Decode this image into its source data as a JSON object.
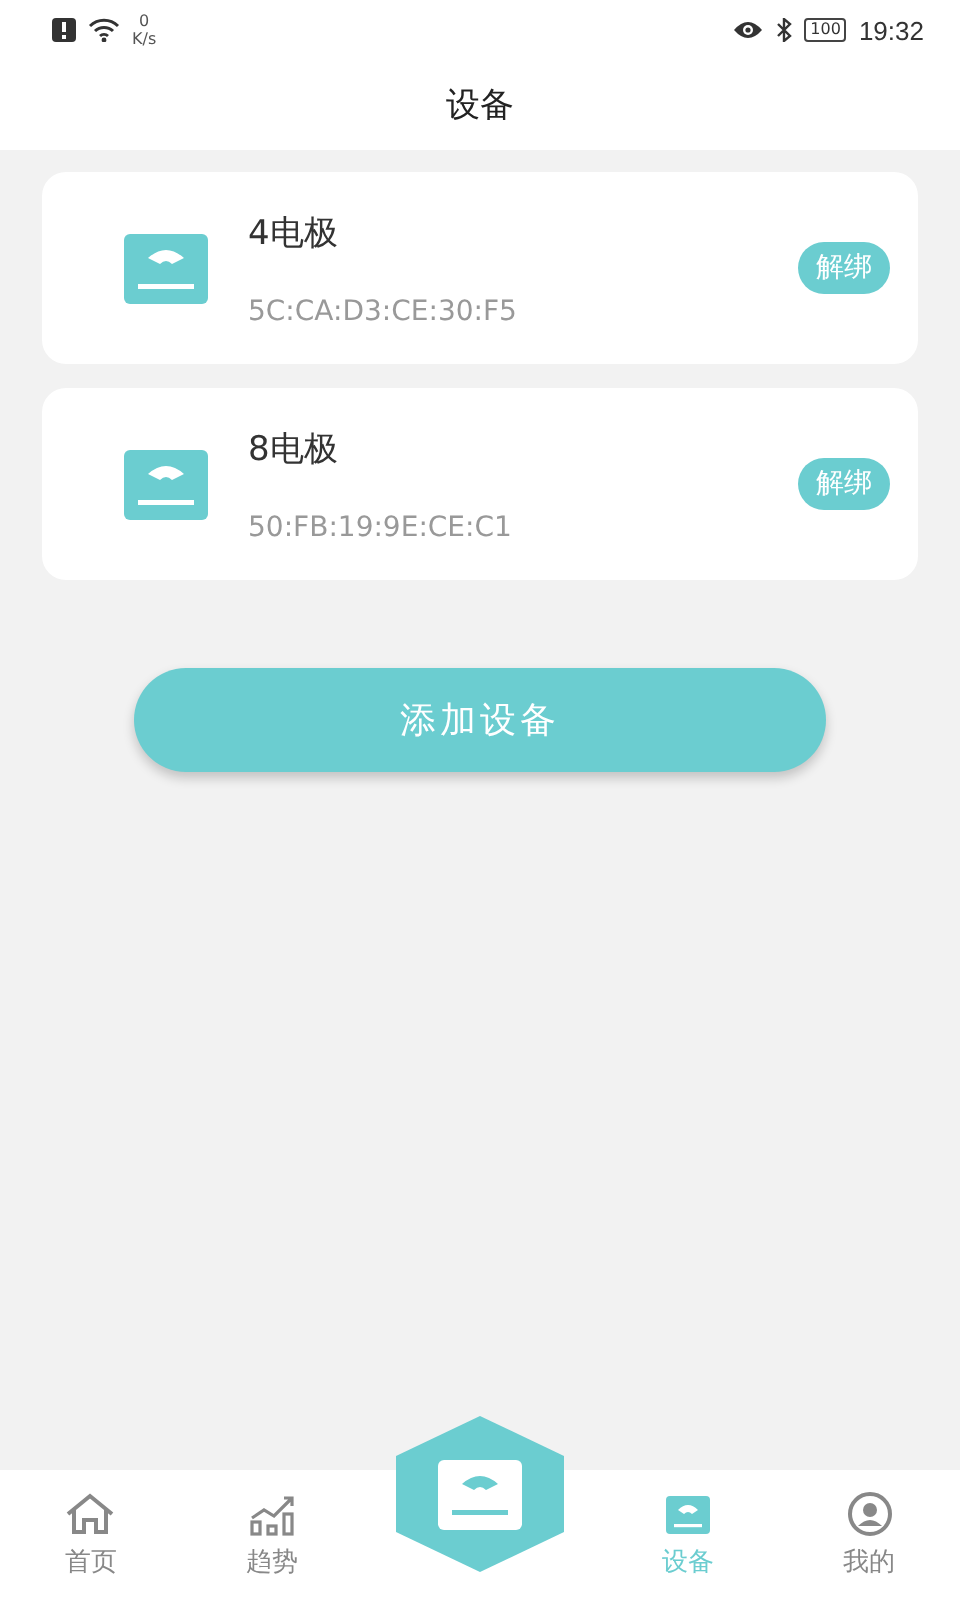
{
  "status_bar": {
    "speed_value": "0",
    "speed_unit": "K/s",
    "battery": "100",
    "time": "19:32"
  },
  "header": {
    "title": "设备"
  },
  "devices": [
    {
      "name": "4电极",
      "mac": "5C:CA:D3:CE:30:F5",
      "action": "解绑"
    },
    {
      "name": "8电极",
      "mac": "50:FB:19:9E:CE:C1",
      "action": "解绑"
    }
  ],
  "add_button": "添加设备",
  "nav": [
    {
      "kind": "home",
      "label": "首页",
      "selected": false
    },
    {
      "kind": "trend",
      "label": "趋势",
      "selected": false
    },
    {
      "kind": "center"
    },
    {
      "kind": "device",
      "label": "设备",
      "selected": true
    },
    {
      "kind": "profile",
      "label": "我的",
      "selected": false
    }
  ]
}
